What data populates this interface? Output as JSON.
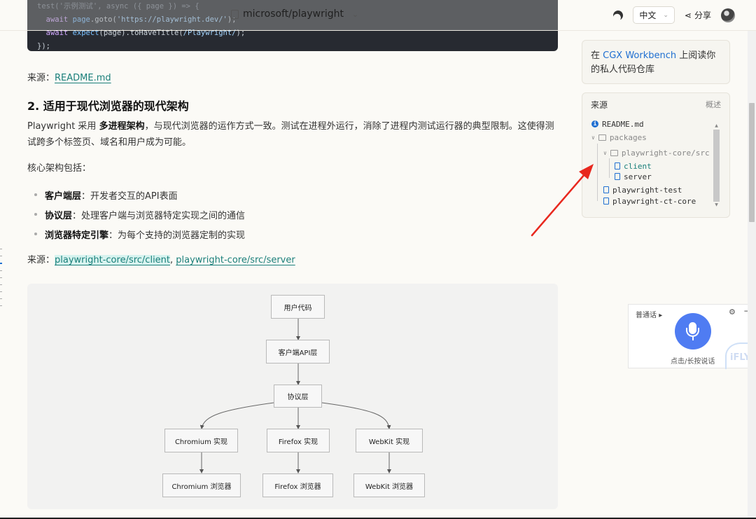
{
  "code": {
    "lines": [
      {
        "text": "test('示例测试', async ({ page }) => {",
        "cls": "dim"
      },
      {
        "text": "  await page.goto('https://playwright.dev/');",
        "cls": ""
      },
      {
        "text": "  await expect(page).toHaveTitle(/Playwright/);",
        "cls": ""
      },
      {
        "text": "});",
        "cls": ""
      }
    ]
  },
  "header": {
    "repo": "microsoft/playwright",
    "lang": "中文",
    "share": "分享"
  },
  "main": {
    "src1_label": "来源：",
    "src1_link": "README.md",
    "section_title": "2. 适用于现代浏览器的现代架构",
    "para_pre": "Playwright 采用 ",
    "para_bold": "多进程架构",
    "para_post": "，与现代浏览器的运作方式一致。测试在进程外运行，消除了进程内测试运行器的典型限制。这使得测试跨多个标签页、域名和用户成为可能。",
    "intro": "核心架构包括：",
    "bullets": [
      {
        "bold": "客户端层",
        "text": "：开发者交互的API表面"
      },
      {
        "bold": "协议层",
        "text": "：处理客户端与浏览器特定实现之间的通信"
      },
      {
        "bold": "浏览器特定引擎",
        "text": "：为每个支持的浏览器定制的实现"
      }
    ],
    "src2_label": "来源：",
    "src2_link1": "playwright-core/src/client",
    "src2_sep": ", ",
    "src2_link2": "playwright-core/src/server"
  },
  "diagram": {
    "user_code": "用户代码",
    "client_api": "客户端API层",
    "protocol": "协议层",
    "chromium_impl": "Chromium 实现",
    "firefox_impl": "Firefox 实现",
    "webkit_impl": "WebKit 实现",
    "chromium_browser": "Chromium 浏览器",
    "firefox_browser": "Firefox 浏览器",
    "webkit_browser": "WebKit 浏览器"
  },
  "workbench": {
    "pre": "在 ",
    "link": "CGX Workbench",
    "post": " 上阅读你的私人代码仓库"
  },
  "sources": {
    "title": "来源",
    "overview": "概述",
    "items": {
      "readme": "README.md",
      "packages": "packages",
      "core_src": "playwright-core/src",
      "client": "client",
      "server": "server",
      "test": "playwright-test",
      "ct_core": "playwright-ct-core"
    }
  },
  "voice": {
    "lang": "普通话",
    "hint": "点击/长按说话",
    "logo": "iFLY"
  },
  "colors": {
    "accent": "#1a7f7a",
    "link_blue": "#1f6fd1",
    "mic_blue": "#4f7cf2",
    "annotation_red": "#e8281e"
  }
}
